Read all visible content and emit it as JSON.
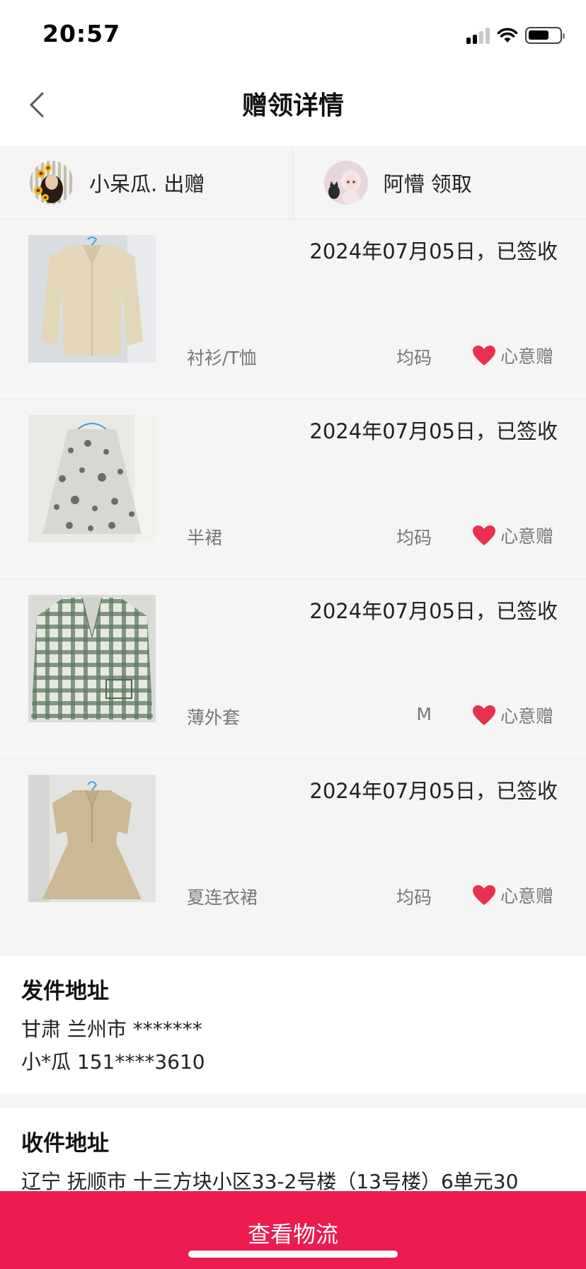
{
  "status_bar": {
    "time": "20:57"
  },
  "nav": {
    "title": "赠领详情",
    "back_icon": "chevron-left-icon"
  },
  "parties": [
    {
      "name": "小呆瓜. 出赠"
    },
    {
      "name": "阿懵 领取"
    }
  ],
  "items": [
    {
      "status": "2024年07月05日，已签收",
      "category": "衬衫/T恤",
      "size": "均码",
      "gift": "心意赠"
    },
    {
      "status": "2024年07月05日，已签收",
      "category": "半裙",
      "size": "均码",
      "gift": "心意赠"
    },
    {
      "status": "2024年07月05日，已签收",
      "category": "薄外套",
      "size": "M",
      "gift": "心意赠"
    },
    {
      "status": "2024年07月05日，已签收",
      "category": "夏连衣裙",
      "size": "均码",
      "gift": "心意赠"
    }
  ],
  "send_address": {
    "title": "发件地址",
    "line1": "甘肃 兰州市 *******",
    "line2": "小*瓜 151****3610"
  },
  "receive_address": {
    "title": "收件地址",
    "line1": "辽宁 抚顺市 十三方块小区33-2号楼（13号楼）6单元30"
  },
  "bottom_button": {
    "label": "查看物流"
  },
  "colors": {
    "accent": "#ec1c50",
    "heart": "#e8304f",
    "background": "#f5f5f5"
  }
}
